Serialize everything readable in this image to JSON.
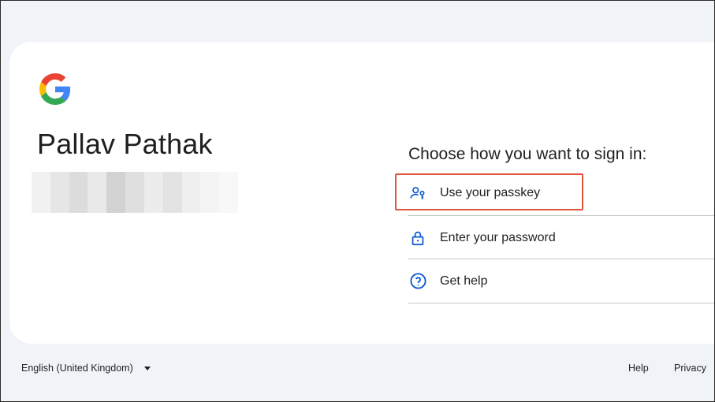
{
  "account": {
    "name": "Pallav Pathak"
  },
  "signin": {
    "prompt": "Choose how you want to sign in:",
    "options": [
      {
        "label": "Use your passkey",
        "icon": "passkey-icon"
      },
      {
        "label": "Enter your password",
        "icon": "lock-icon"
      },
      {
        "label": "Get help",
        "icon": "help-icon"
      }
    ]
  },
  "footer": {
    "language": "English (United Kingdom)",
    "help": "Help",
    "privacy": "Privacy"
  },
  "colors": {
    "background": "#f0f4f9",
    "card": "#ffffff",
    "icon_blue": "#0b57d0",
    "highlight": "#e0553f",
    "divider": "#c7c7c7"
  }
}
